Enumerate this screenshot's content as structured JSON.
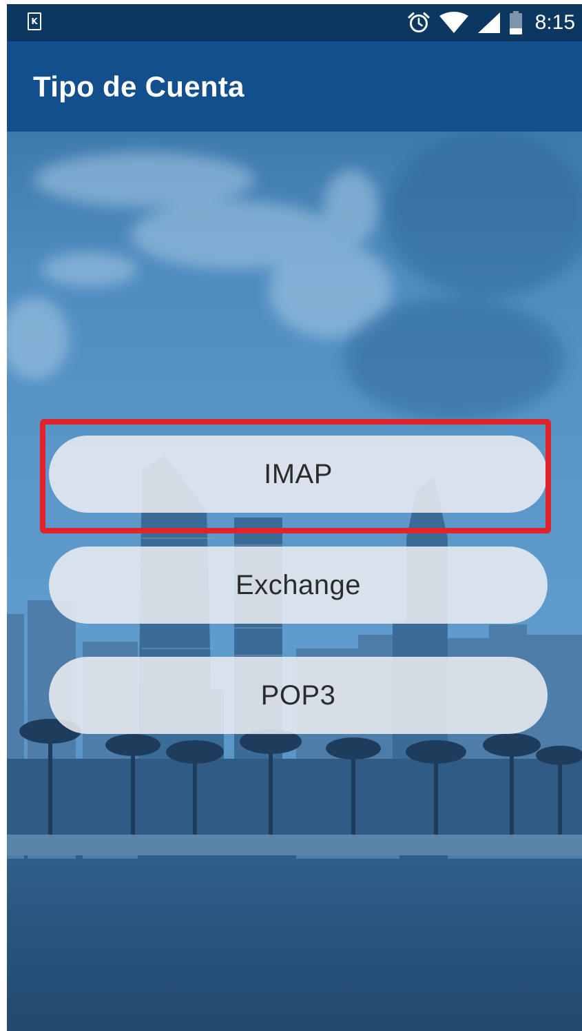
{
  "status_bar": {
    "app_icon_letter": "K",
    "time": "8:15",
    "icons": [
      "alarm-icon",
      "wifi-icon",
      "cell-signal-icon",
      "battery-icon"
    ]
  },
  "app_bar": {
    "title": "Tipo de Cuenta"
  },
  "account_types": [
    {
      "label": "IMAP",
      "highlighted": true
    },
    {
      "label": "Exchange",
      "highlighted": false
    },
    {
      "label": "POP3",
      "highlighted": false
    }
  ],
  "colors": {
    "status_bar": "#0c3761",
    "app_bar": "#124f8c",
    "highlight": "#e3232b",
    "button_fill": "#eceef2"
  }
}
